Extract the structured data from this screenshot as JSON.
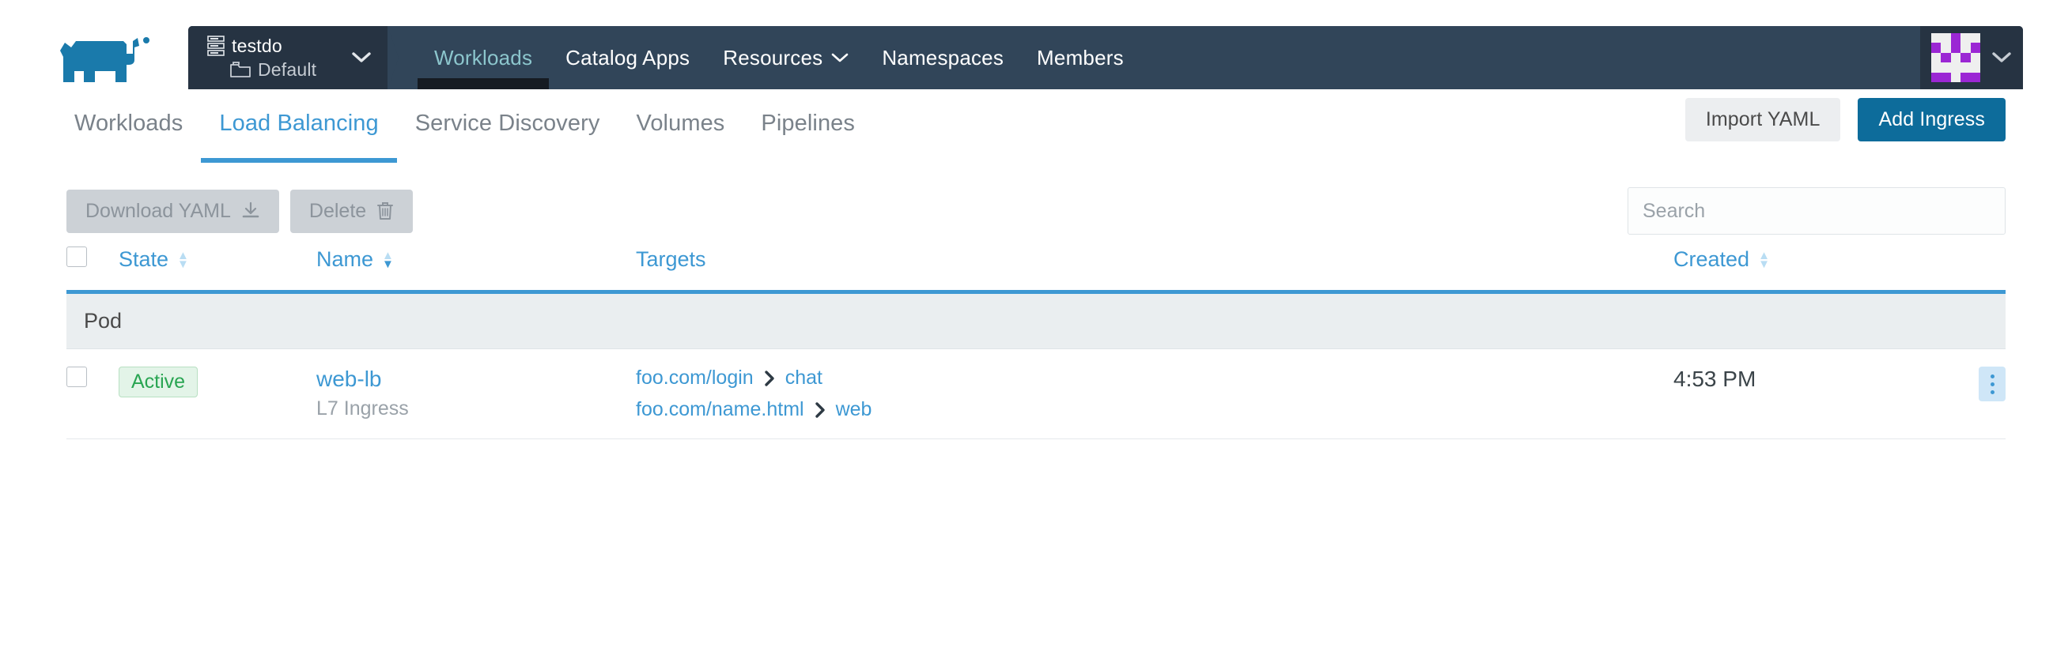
{
  "header": {
    "logo_name": "rancher-logo",
    "cluster": {
      "name": "testdo",
      "icon": "cluster-stack-icon"
    },
    "project": {
      "name": "Default",
      "icon": "folder-icon"
    },
    "nav": [
      {
        "label": "Workloads",
        "active": true,
        "caret": false
      },
      {
        "label": "Catalog Apps",
        "active": false,
        "caret": false
      },
      {
        "label": "Resources",
        "active": false,
        "caret": true
      },
      {
        "label": "Namespaces",
        "active": false,
        "caret": false
      },
      {
        "label": "Members",
        "active": false,
        "caret": false
      }
    ],
    "user": {
      "avatar_name": "user-avatar-identicon",
      "avatar_color": "#9b27d4",
      "avatar_bg": "#efefef",
      "avatar_matrix": [
        [
          0,
          0,
          1,
          0,
          0
        ],
        [
          1,
          0,
          1,
          0,
          1
        ],
        [
          0,
          1,
          0,
          1,
          0
        ],
        [
          0,
          0,
          0,
          0,
          0
        ],
        [
          1,
          1,
          0,
          1,
          1
        ]
      ]
    },
    "colors": {
      "bar": "#314559",
      "panel": "#263342",
      "active_text": "#8cc6cd"
    }
  },
  "tabs": {
    "items": [
      {
        "label": "Workloads",
        "active": false
      },
      {
        "label": "Load Balancing",
        "active": true
      },
      {
        "label": "Service Discovery",
        "active": false
      },
      {
        "label": "Volumes",
        "active": false
      },
      {
        "label": "Pipelines",
        "active": false
      }
    ],
    "import_yaml_label": "Import YAML",
    "add_ingress_label": "Add Ingress",
    "accent": "#3d98d3"
  },
  "toolbar": {
    "download_yaml_label": "Download YAML",
    "download_icon": "download-icon",
    "delete_label": "Delete",
    "delete_icon": "trash-icon",
    "search_placeholder": "Search",
    "search_value": ""
  },
  "table": {
    "columns": [
      {
        "key": "check",
        "label": "",
        "sortable": false
      },
      {
        "key": "state",
        "label": "State",
        "sortable": true,
        "sort": "none"
      },
      {
        "key": "name",
        "label": "Name",
        "sortable": true,
        "sort": "desc"
      },
      {
        "key": "targets",
        "label": "Targets",
        "sortable": false
      },
      {
        "key": "created",
        "label": "Created",
        "sortable": true,
        "sort": "none"
      },
      {
        "key": "menu",
        "label": "",
        "sortable": false
      }
    ],
    "groups": [
      {
        "label": "Pod",
        "rows": [
          {
            "state": "Active",
            "name": "web-lb",
            "subtitle": "L7 Ingress",
            "targets": [
              {
                "host": "foo.com/login",
                "arrow": "›",
                "service": "chat"
              },
              {
                "host": "foo.com/name.html",
                "arrow": "›",
                "service": "web"
              }
            ],
            "created": "4:53 PM",
            "menu_icon": "kebab-menu-icon"
          }
        ]
      }
    ]
  }
}
